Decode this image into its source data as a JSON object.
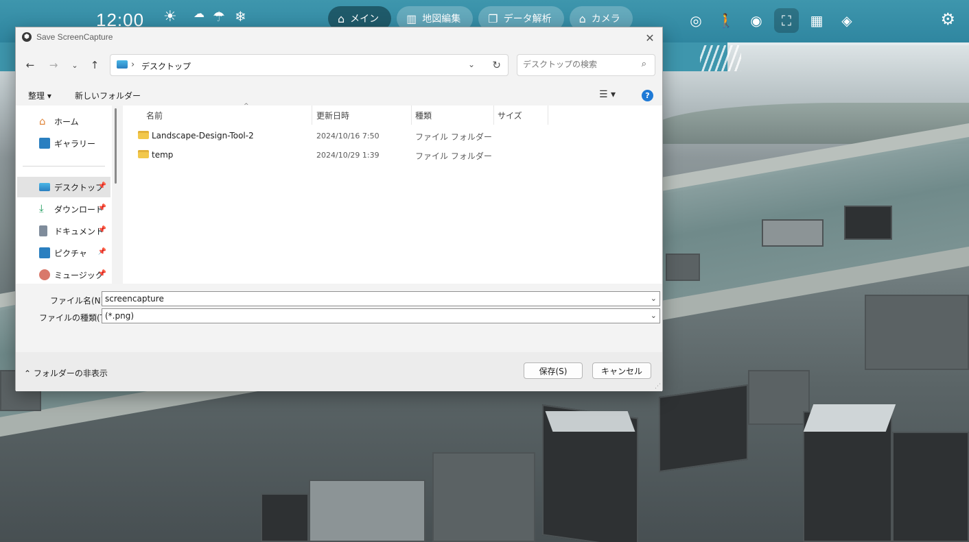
{
  "topbar": {
    "clock": "12:00",
    "weather": [
      "☀",
      "☁",
      "☂",
      "❄"
    ],
    "tabs": [
      {
        "icon": "home-icon",
        "label": "メイン",
        "active": true
      },
      {
        "icon": "building-icon",
        "label": "地図編集",
        "active": false
      },
      {
        "icon": "copy-icon",
        "label": "データ解析",
        "active": false
      },
      {
        "icon": "camera-icon",
        "label": "カメラ",
        "active": false
      }
    ],
    "tools": [
      "screenshot-icon",
      "walk-icon",
      "eye-icon",
      "capture-icon",
      "building-grid-icon",
      "texture-icon"
    ],
    "accent": "#3e96ad"
  },
  "dialog": {
    "title": "Save ScreenCapture",
    "address": {
      "location": "デスクトップ"
    },
    "search": {
      "placeholder": "デスクトップの検索"
    },
    "commands": {
      "organize": "整理 ▾",
      "new_folder": "新しいフォルダー"
    },
    "columns": {
      "name": "名前",
      "date": "更新日時",
      "type": "種類",
      "size": "サイズ"
    },
    "sidebar": [
      {
        "label": "ホーム",
        "icon": "home-icon"
      },
      {
        "label": "ギャラリー",
        "icon": "gallery-icon"
      },
      {
        "label": "デスクトップ",
        "icon": "desktop-icon",
        "active": true
      },
      {
        "label": "ダウンロード",
        "icon": "download-icon"
      },
      {
        "label": "ドキュメント",
        "icon": "document-icon"
      },
      {
        "label": "ピクチャ",
        "icon": "pictures-icon"
      },
      {
        "label": "ミュージック",
        "icon": "music-icon"
      }
    ],
    "files": [
      {
        "name": "Landscape-Design-Tool-2",
        "date": "2024/10/16 7:50",
        "type": "ファイル フォルダー"
      },
      {
        "name": "temp",
        "date": "2024/10/29 1:39",
        "type": "ファイル フォルダー"
      }
    ],
    "filename_label": "ファイル名(N):",
    "filename_value": "screencapture",
    "filetype_label": "ファイルの種類(T):",
    "filetype_value": "(*.png)",
    "hide_folders": "フォルダーの非表示",
    "save": "保存(S)",
    "cancel": "キャンセル"
  }
}
